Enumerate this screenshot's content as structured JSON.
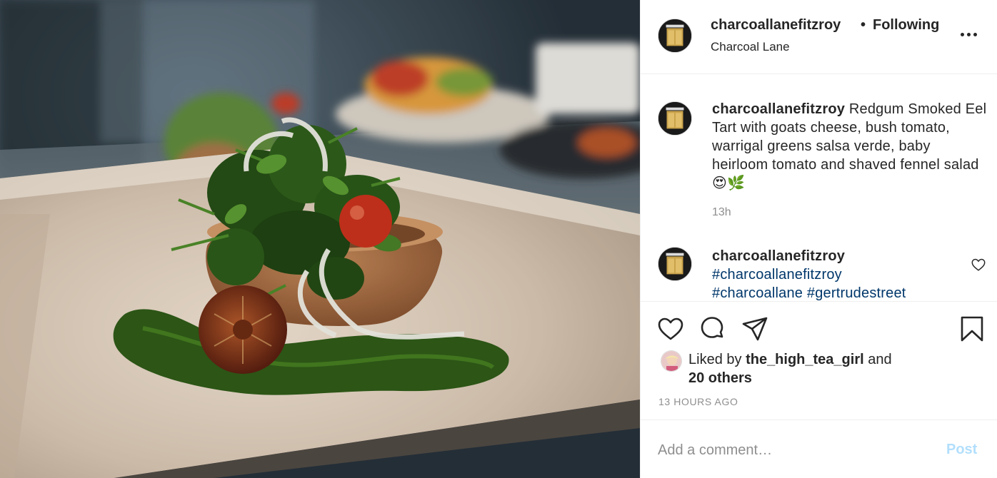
{
  "post": {
    "username": "charcoallanefitzroy",
    "follow_status": "Following",
    "follow_separator": "•",
    "location": "Charcoal Lane"
  },
  "caption": {
    "username": "charcoallanefitzroy",
    "text": "Redgum Smoked Eel Tart with goats cheese, bush tomato, warrigal greens salsa verde, baby heirloom tomato and shaved fennel salad 😍🌿",
    "time": "13h"
  },
  "comment": {
    "username": "charcoallanefitzroy",
    "hashtags": [
      "#charcoallanefitzroy",
      "#charcoallane",
      "#gertrudestreet"
    ]
  },
  "likes": {
    "prefix": "Liked by",
    "user": "the_high_tea_girl",
    "joiner": "and",
    "others": "20 others"
  },
  "timestamp": "13 HOURS AGO",
  "add_comment": {
    "placeholder": "Add a comment…",
    "post_label": "Post"
  },
  "icons": {
    "like": "heart-icon",
    "comment": "speech-bubble-icon",
    "share": "paper-plane-icon",
    "save": "bookmark-icon",
    "more": "ellipsis-icon",
    "comment_like": "small-heart-icon"
  },
  "colors": {
    "link": "#00376b",
    "muted": "#8e8e8e",
    "post_button": "#b2dffc",
    "text": "#262626"
  }
}
